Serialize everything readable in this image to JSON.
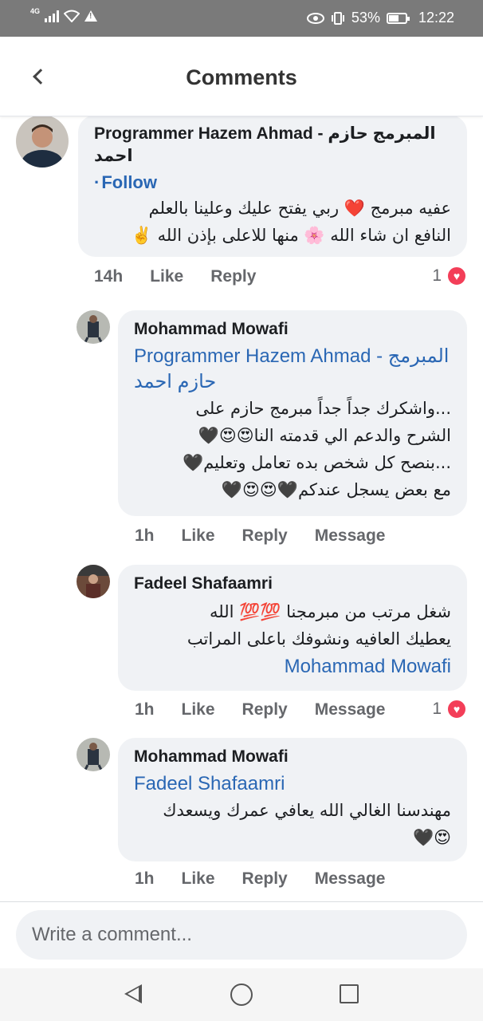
{
  "status_bar": {
    "network": "4G",
    "battery": "53%",
    "time": "12:22"
  },
  "header": {
    "title": "Comments"
  },
  "comments": [
    {
      "author": "Programmer Hazem Ahmad - المبرمج حازم احمد",
      "follow_label": "Follow",
      "text_lines": [
        "عفيه مبرمج ❤️ ربي يفتح عليك وعلينا بالعلم",
        "النافع ان شاء الله 🌸 منها للاعلى بإذن الله ✌️"
      ],
      "time": "14h",
      "like_label": "Like",
      "reply_label": "Reply",
      "reaction_count": "1"
    },
    {
      "author": "Mohammad Mowafi",
      "mention": "Programmer Hazem Ahmad - المبرمج حازم احمد",
      "text_lines": [
        "...واشكرك جداً جداً مبرمج حازم على",
        "الشرح والدعم الي قدمته النا😍😍🖤",
        "...بنصح كل شخص بده تعامل وتعليم🖤",
        "مع بعض يسجل عندكم🖤😍😍🖤"
      ],
      "time": "1h",
      "like_label": "Like",
      "reply_label": "Reply",
      "message_label": "Message"
    },
    {
      "author": "Fadeel Shafaamri",
      "text_lines": [
        "شغل مرتب من مبرمجنا 💯💯 الله",
        "يعطيك العافيه ونشوفك باعلى المراتب"
      ],
      "mention": "Mohammad Mowafi",
      "time": "1h",
      "like_label": "Like",
      "reply_label": "Reply",
      "message_label": "Message",
      "reaction_count": "1"
    },
    {
      "author": "Mohammad Mowafi",
      "mention": "Fadeel Shafaamri",
      "text_lines": [
        "مهندسنا الغالي الله يعافي عمرك ويسعدك",
        "😍🖤"
      ],
      "time": "1h",
      "like_label": "Like",
      "reply_label": "Reply",
      "message_label": "Message"
    }
  ],
  "composer": {
    "placeholder": "Write a comment..."
  },
  "colors": {
    "link": "#2a67b4",
    "bubble": "#f0f2f5",
    "heart_reaction": "#f33e58"
  }
}
